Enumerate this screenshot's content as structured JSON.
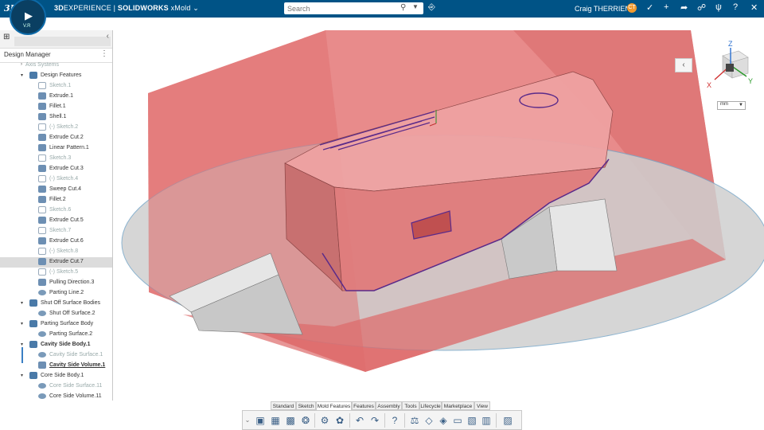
{
  "topbar": {
    "brand_bold": "3D",
    "brand_rest": "EXPERIENCE | ",
    "app_bold": "SOLIDWORKS",
    "app_rest": " xMold",
    "search_placeholder": "Search",
    "user_name": "Craig THERRIEN",
    "avatar_initials": "CT",
    "compass_version": "V.R",
    "logo_text": "3DS"
  },
  "left_panel": {
    "title": "Design Manager",
    "tree": [
      {
        "label": "Axis Systems",
        "indent": 1,
        "icon": "none",
        "state": "dim",
        "arrow": "›"
      },
      {
        "label": "Design Features",
        "indent": 1,
        "icon": "group-icon",
        "state": "normal",
        "arrow": "▾"
      },
      {
        "label": "Sketch.1",
        "indent": 2,
        "icon": "sketch-icon",
        "state": "dim",
        "arrow": ""
      },
      {
        "label": "Extrude.1",
        "indent": 2,
        "icon": "feature-icon",
        "state": "normal",
        "arrow": ""
      },
      {
        "label": "Fillet.1",
        "indent": 2,
        "icon": "feature-icon",
        "state": "normal",
        "arrow": ""
      },
      {
        "label": "Shell.1",
        "indent": 2,
        "icon": "feature-icon",
        "state": "normal",
        "arrow": ""
      },
      {
        "label": "(-)  Sketch.2",
        "indent": 2,
        "icon": "sketch-icon",
        "state": "dim",
        "arrow": ""
      },
      {
        "label": "Extrude Cut.2",
        "indent": 2,
        "icon": "feature-icon",
        "state": "normal",
        "arrow": ""
      },
      {
        "label": "Linear Pattern.1",
        "indent": 2,
        "icon": "feature-icon",
        "state": "normal",
        "arrow": ""
      },
      {
        "label": "Sketch.3",
        "indent": 2,
        "icon": "sketch-icon",
        "state": "dim",
        "arrow": ""
      },
      {
        "label": "Extrude Cut.3",
        "indent": 2,
        "icon": "feature-icon",
        "state": "normal",
        "arrow": ""
      },
      {
        "label": "(-)  Sketch.4",
        "indent": 2,
        "icon": "sketch-icon",
        "state": "dim",
        "arrow": ""
      },
      {
        "label": "Sweep Cut.4",
        "indent": 2,
        "icon": "feature-icon",
        "state": "normal",
        "arrow": ""
      },
      {
        "label": "Fillet.2",
        "indent": 2,
        "icon": "feature-icon",
        "state": "normal",
        "arrow": ""
      },
      {
        "label": "Sketch.6",
        "indent": 2,
        "icon": "sketch-icon",
        "state": "dim",
        "arrow": ""
      },
      {
        "label": "Extrude Cut.5",
        "indent": 2,
        "icon": "feature-icon",
        "state": "normal",
        "arrow": ""
      },
      {
        "label": "Sketch.7",
        "indent": 2,
        "icon": "sketch-icon",
        "state": "dim",
        "arrow": ""
      },
      {
        "label": "Extrude Cut.6",
        "indent": 2,
        "icon": "feature-icon",
        "state": "normal",
        "arrow": ""
      },
      {
        "label": "(-)  Sketch.8",
        "indent": 2,
        "icon": "sketch-icon",
        "state": "dim",
        "arrow": ""
      },
      {
        "label": "Extrude Cut.7",
        "indent": 2,
        "icon": "feature-icon",
        "state": "selected",
        "arrow": ""
      },
      {
        "label": "(-)  Sketch.5",
        "indent": 2,
        "icon": "sketch-icon",
        "state": "dim",
        "arrow": ""
      },
      {
        "label": "Pulling Direction.3",
        "indent": 2,
        "icon": "feature-icon",
        "state": "normal",
        "arrow": ""
      },
      {
        "label": "Parting Line.2",
        "indent": 2,
        "icon": "surface-icon",
        "state": "normal",
        "arrow": ""
      },
      {
        "label": "Shut Off Surface Bodies",
        "indent": 1,
        "icon": "group-icon",
        "state": "normal",
        "arrow": "▾"
      },
      {
        "label": "Shut Off Surface.2",
        "indent": 2,
        "icon": "surface-icon",
        "state": "normal",
        "arrow": ""
      },
      {
        "label": "Parting Surface Body",
        "indent": 1,
        "icon": "group-icon",
        "state": "normal",
        "arrow": "▾"
      },
      {
        "label": "Parting Surface.2",
        "indent": 2,
        "icon": "surface-icon",
        "state": "normal",
        "arrow": ""
      },
      {
        "label": "Cavity Side Body.1",
        "indent": 1,
        "icon": "group-icon",
        "state": "bold",
        "arrow": "▾"
      },
      {
        "label": "Cavity Side Surface.1",
        "indent": 2,
        "icon": "surface-icon",
        "state": "dim",
        "arrow": ""
      },
      {
        "label": "Cavity Side Volume.1",
        "indent": 2,
        "icon": "feature-icon",
        "state": "underline",
        "arrow": ""
      },
      {
        "label": "Core Side Body.1",
        "indent": 1,
        "icon": "group-icon",
        "state": "normal",
        "arrow": "▾"
      },
      {
        "label": "Core Side Surface.11",
        "indent": 2,
        "icon": "surface-icon",
        "state": "dim",
        "arrow": ""
      },
      {
        "label": "Core Side Volume.11",
        "indent": 2,
        "icon": "surface-icon",
        "state": "normal",
        "arrow": ""
      }
    ]
  },
  "viewport": {
    "unit": "mm",
    "axes": {
      "x": "X",
      "y": "Y",
      "z": "Z"
    }
  },
  "action_bar": {
    "tabs": [
      {
        "label": "Standard",
        "active": false
      },
      {
        "label": "Sketch",
        "active": false
      },
      {
        "label": "Mold Features",
        "active": true
      },
      {
        "label": "Features",
        "active": false
      },
      {
        "label": "Assembly",
        "active": false
      },
      {
        "label": "Tools",
        "active": false
      },
      {
        "label": "Lifecycle",
        "active": false
      },
      {
        "label": "Marketplace",
        "active": false
      },
      {
        "label": "View",
        "active": false
      }
    ]
  },
  "colors": {
    "topbar": "#005386",
    "mold_red": "#e06a6a",
    "outline_purple": "#5a2a8a",
    "parting_grey": "#cfcfcf"
  }
}
